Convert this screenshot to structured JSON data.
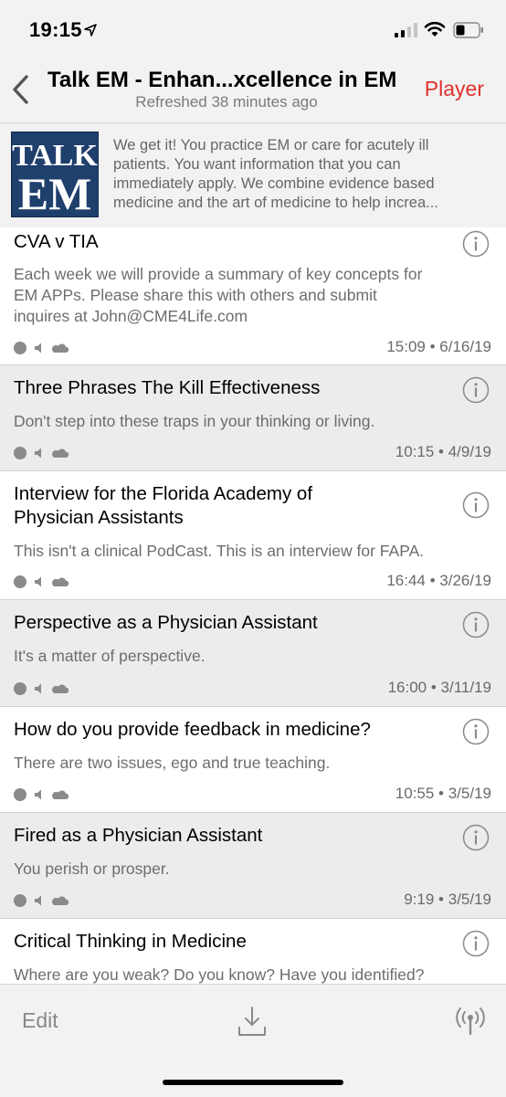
{
  "status_bar": {
    "time": "19:15",
    "icons": [
      "location-arrow-icon",
      "signal-icon",
      "wifi-icon",
      "battery-icon"
    ]
  },
  "nav": {
    "back_icon": "chevron-left-icon",
    "title": "Talk EM - Enhan...xcellence in EM",
    "subtitle": "Refreshed 38 minutes ago",
    "player_label": "Player",
    "accent_color": "#e0312b"
  },
  "podcast": {
    "logo_line1": "TALK",
    "logo_line2": "EM",
    "description_lines": [
      "We get it! You practice EM or care for acutely ill",
      "patients. You want information that you can",
      "immediately apply. We combine evidence based",
      "medicine and the art of medicine to help increa..."
    ]
  },
  "episodes": [
    {
      "title_lines": [
        "CVA v TIA"
      ],
      "desc_lines": [
        "Each week we will provide a summary of key concepts for",
        "EM APPs.  Please share this with others and submit",
        "inquires at John@CME4Life.com"
      ],
      "meta": "15:09 • 6/16/19"
    },
    {
      "title_lines": [
        "Three Phrases The Kill Effectiveness"
      ],
      "desc_lines": [
        "Don't step into these traps in your thinking or living."
      ],
      "meta": "10:15 • 4/9/19"
    },
    {
      "title_lines": [
        "Interview for the Florida Academy of",
        "Physician Assistants"
      ],
      "desc_lines": [
        "This isn't a clinical PodCast.  This is an interview for FAPA."
      ],
      "meta": "16:44 • 3/26/19"
    },
    {
      "title_lines": [
        "Perspective as a Physician Assistant"
      ],
      "desc_lines": [
        "It's a matter of perspective."
      ],
      "meta": "16:00 • 3/11/19"
    },
    {
      "title_lines": [
        "How do you provide feedback in medicine?"
      ],
      "desc_lines": [
        "There are two issues, ego and true teaching."
      ],
      "meta": "10:55 • 3/5/19"
    },
    {
      "title_lines": [
        "Fired as a Physician Assistant"
      ],
      "desc_lines": [
        "You perish or prosper."
      ],
      "meta": "9:19 • 3/5/19"
    },
    {
      "title_lines": [
        "Critical Thinking in Medicine"
      ],
      "desc_lines": [
        "Where are you weak?  Do you know?  Have you identified?"
      ],
      "meta": ""
    }
  ],
  "toolbar": {
    "edit_label": "Edit",
    "download_icon": "download-icon",
    "antenna_icon": "antenna-icon"
  }
}
